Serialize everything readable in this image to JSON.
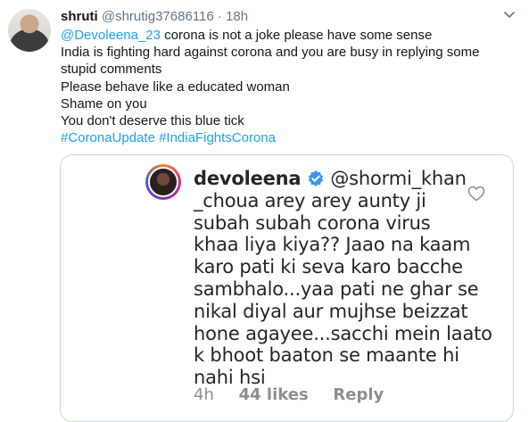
{
  "tweet": {
    "author_name": "shruti",
    "author_handle": "@shrutig37686116",
    "separator": "·",
    "timestamp": "18h",
    "lines": [
      {
        "mention": "@Devoleena_23",
        "text": " corona is not a joke please have some sense"
      },
      {
        "mention": "",
        "text": "India is fighting hard against corona and you are busy in replying some"
      },
      {
        "mention": "",
        "text": "stupid comments"
      },
      {
        "mention": "",
        "text": "Please behave like a educated woman"
      },
      {
        "mention": "",
        "text": "Shame on you"
      },
      {
        "mention": "",
        "text": "You don't deserve this blue tick"
      }
    ],
    "hashtags": "#CoronaUpdate #IndiaFightsCorona"
  },
  "quoted_comment": {
    "username": "devoleena",
    "mention_part1": "@shormi_khan",
    "mention_part2": "_choua",
    "lines": [
      " arey arey aunty ji",
      "subah subah corona virus",
      "khaa liya kiya?? Jaao na kaam",
      "karo pati ki seva karo bacche",
      "sambhalo...yaa pati ne ghar se",
      "nikal diyal aur mujhse beizzat",
      "hone agayee...sacchi mein laato",
      "k bhoot baaton se maante hi",
      "nahi hsi"
    ],
    "age": "4h",
    "likes": "44 likes",
    "reply": "Reply"
  },
  "icons": {
    "caret": "chevron-down-icon",
    "verified": "verified-badge-icon",
    "like": "heart-outline-icon"
  },
  "colors": {
    "link": "#1da1f2",
    "verified": "#3897f0",
    "muted": "#657786"
  }
}
